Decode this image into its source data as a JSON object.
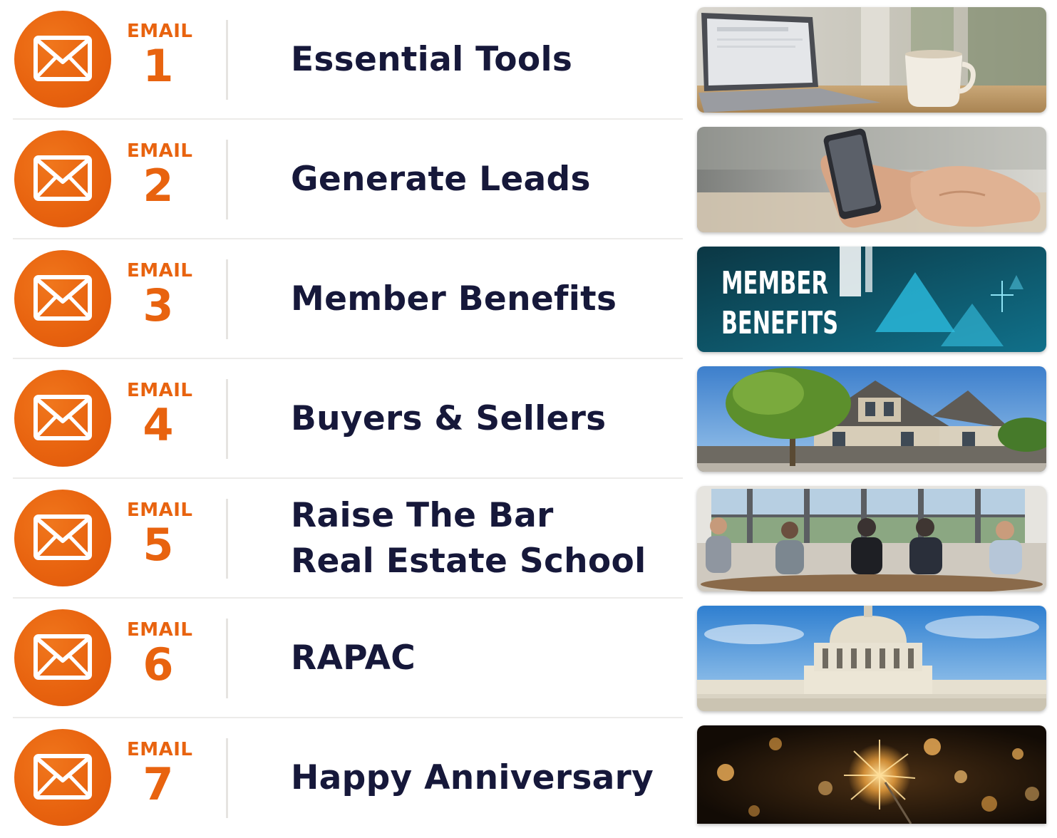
{
  "emails": [
    {
      "label": "EMAIL",
      "number": "1",
      "title_lines": [
        "Essential Tools"
      ],
      "icon": "mail-icon",
      "image": "laptop-coffee-photo"
    },
    {
      "label": "EMAIL",
      "number": "2",
      "title_lines": [
        "Generate Leads"
      ],
      "icon": "mail-icon",
      "image": "hands-phone-photo"
    },
    {
      "label": "EMAIL",
      "number": "3",
      "title_lines": [
        "Member Benefits"
      ],
      "icon": "mail-icon",
      "image": "member-benefits-banner",
      "image_text": [
        "MEMBER",
        "BENEFITS"
      ]
    },
    {
      "label": "EMAIL",
      "number": "4",
      "title_lines": [
        "Buyers & Sellers"
      ],
      "icon": "mail-icon",
      "image": "house-photo"
    },
    {
      "label": "EMAIL",
      "number": "5",
      "title_lines": [
        "Raise The Bar",
        "Real Estate School"
      ],
      "icon": "mail-icon",
      "image": "classroom-photo"
    },
    {
      "label": "EMAIL",
      "number": "6",
      "title_lines": [
        "RAPAC"
      ],
      "icon": "mail-icon",
      "image": "capitol-building-photo"
    },
    {
      "label": "EMAIL",
      "number": "7",
      "title_lines": [
        "Happy Anniversary"
      ],
      "icon": "mail-icon",
      "image": "sparkler-photo"
    }
  ],
  "colors": {
    "accent": "#e8630f",
    "title": "#16183a",
    "divider": "#e6e4e1",
    "background": "#ffffff"
  }
}
